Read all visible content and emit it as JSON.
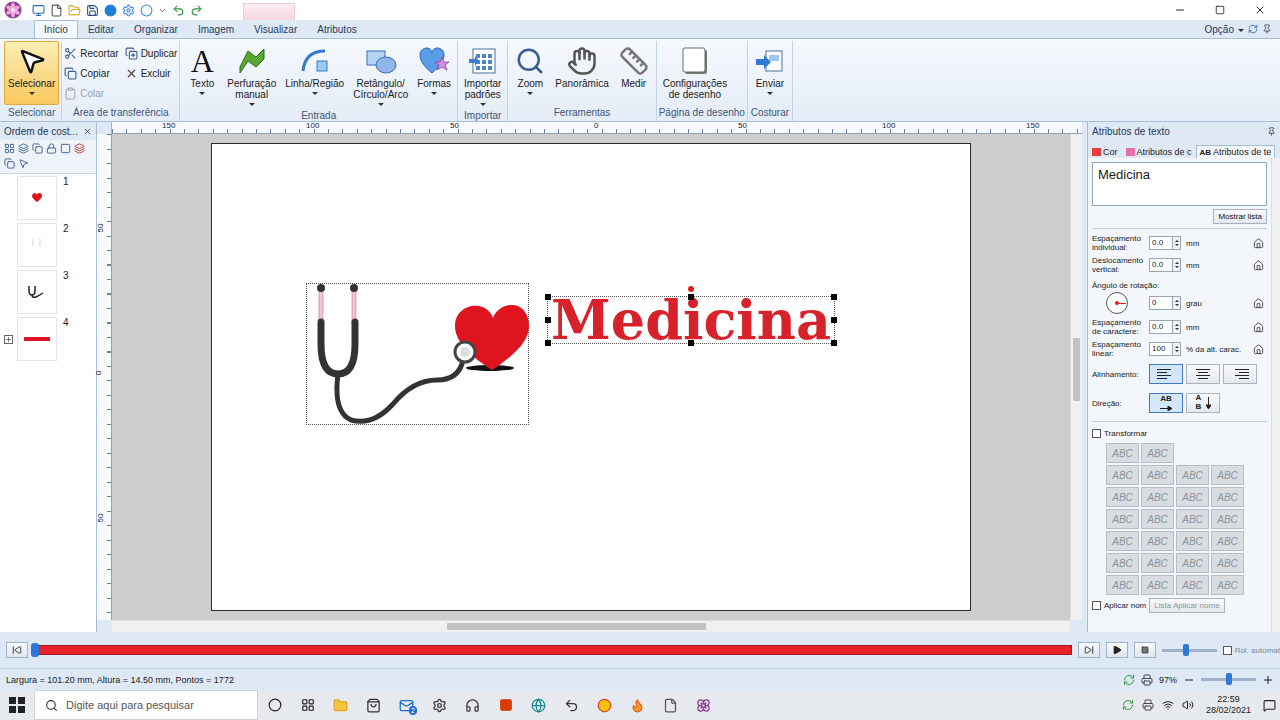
{
  "ribbon": {
    "tabs": [
      {
        "label": "Início",
        "selected": true
      },
      {
        "label": "Editar",
        "selected": false
      },
      {
        "label": "Organizar",
        "selected": false
      },
      {
        "label": "Imagem",
        "selected": false
      },
      {
        "label": "Visualizar",
        "selected": false
      },
      {
        "label": "Atributos",
        "selected": false
      }
    ],
    "option": "Opção",
    "groups": [
      {
        "label": "Selecionar",
        "buttons": [
          {
            "lines": [
              "Selecionar"
            ],
            "size": "large",
            "dropdown": true,
            "selected": true,
            "disabled": false
          }
        ]
      },
      {
        "label": "Área de transferência",
        "buttons": [
          {
            "lines": [
              "Recortar"
            ],
            "size": "small",
            "dropdown": false,
            "selected": false,
            "disabled": false
          },
          {
            "lines": [
              "Copiar"
            ],
            "size": "small",
            "dropdown": false,
            "selected": false,
            "disabled": false
          },
          {
            "lines": [
              "Colar"
            ],
            "size": "small",
            "dropdown": false,
            "selected": false,
            "disabled": true
          },
          {
            "lines": [
              "Duplicar"
            ],
            "size": "small",
            "dropdown": false,
            "selected": false,
            "disabled": false
          },
          {
            "lines": [
              "Excluir"
            ],
            "size": "small",
            "dropdown": false,
            "selected": false,
            "disabled": false
          }
        ]
      },
      {
        "label": "Entrada",
        "buttons": [
          {
            "lines": [
              "Texto"
            ],
            "glyph": "A",
            "size": "large",
            "dropdown": true,
            "selected": false,
            "disabled": false
          },
          {
            "lines": [
              "Perfuração",
              "manual"
            ],
            "size": "large",
            "dropdown": true,
            "selected": false,
            "disabled": false
          },
          {
            "lines": [
              "Linha/Região"
            ],
            "size": "large",
            "dropdown": true,
            "selected": false,
            "disabled": false
          },
          {
            "lines": [
              "Retângulo/",
              "Círculo/Arco"
            ],
            "size": "large",
            "dropdown": true,
            "selected": false,
            "disabled": false
          },
          {
            "lines": [
              "Formas"
            ],
            "size": "large",
            "dropdown": true,
            "selected": false,
            "disabled": false
          }
        ]
      },
      {
        "label": "Importar",
        "buttons": [
          {
            "lines": [
              "Importar",
              "padrões"
            ],
            "size": "large",
            "dropdown": true,
            "selected": false,
            "disabled": false
          }
        ]
      },
      {
        "label": "Ferramentas",
        "buttons": [
          {
            "lines": [
              "Zoom"
            ],
            "size": "large",
            "dropdown": true,
            "selected": false,
            "disabled": false
          },
          {
            "lines": [
              "Panorâmica"
            ],
            "size": "large",
            "dropdown": false,
            "selected": false,
            "disabled": false
          },
          {
            "lines": [
              "Medir"
            ],
            "size": "large",
            "dropdown": false,
            "selected": false,
            "disabled": false
          }
        ]
      },
      {
        "label": "Página de desenho",
        "buttons": [
          {
            "lines": [
              "Configurações",
              "de desenho"
            ],
            "size": "large",
            "dropdown": false,
            "selected": false,
            "disabled": false
          }
        ]
      },
      {
        "label": "Costurar",
        "buttons": [
          {
            "lines": [
              "Enviar"
            ],
            "size": "large",
            "dropdown": true,
            "selected": false,
            "disabled": false
          }
        ]
      }
    ]
  },
  "order_panel": {
    "title": "Ordem de cost...",
    "items": [
      {
        "number": "1",
        "kind": "heart",
        "group": false
      },
      {
        "number": "2",
        "kind": "tube",
        "group": false
      },
      {
        "number": "3",
        "kind": "stethoscope",
        "group": false
      },
      {
        "number": "4",
        "kind": "text",
        "group": true
      }
    ]
  },
  "rulers": {
    "horizontal": [
      "150",
      "100",
      "50",
      "0",
      "50",
      "100",
      "150"
    ],
    "vertical": [
      "50",
      "0",
      "50"
    ]
  },
  "canvas": {
    "elements": [
      {
        "kind": "stethoscope",
        "selected": false
      },
      {
        "kind": "text",
        "text": "Medicina",
        "selected": true
      }
    ]
  },
  "attributes_panel": {
    "title": "Atributos de texto",
    "tabs": [
      {
        "label": "Cor",
        "glyph": "",
        "selected": false
      },
      {
        "label": "Atributos de c",
        "glyph": "",
        "selected": false
      },
      {
        "label": "Atributos de te",
        "glyph": "AB",
        "selected": true
      }
    ],
    "text_value": "Medicina",
    "show_list": "Mostrar lista",
    "fields": [
      {
        "kind": "spin",
        "label": "Espaçamento individual:",
        "value": "0.0",
        "unit": "mm"
      },
      {
        "kind": "spin",
        "label": "Deslocamento vertical:",
        "value": "0.0",
        "unit": "mm"
      },
      {
        "kind": "rotation",
        "label": "Ângulo de rotação:",
        "value": "0",
        "unit": "grau"
      },
      {
        "kind": "spin",
        "label": "Espaçamento de caractere:",
        "value": "0.0",
        "unit": "mm"
      },
      {
        "kind": "spin",
        "label": "Espaçamento linear:",
        "value": "100",
        "unit": "% da alt. carac."
      }
    ],
    "alignment": {
      "label": "Alinhamento:",
      "options": [
        {
          "value": "left",
          "selected": true
        },
        {
          "value": "center",
          "selected": false
        },
        {
          "value": "right",
          "selected": false
        }
      ]
    },
    "direction": {
      "label": "Direção:",
      "options": [
        {
          "kind": "horizontal",
          "glyph": "AB",
          "selected": true
        },
        {
          "kind": "vertical",
          "glyph": "AB",
          "selected": false
        }
      ]
    },
    "transform": {
      "label": "Transformar",
      "checked": false,
      "presets": [
        "ABC",
        "ABC",
        "ABC",
        "ABC",
        "ABC",
        "ABC",
        "ABC",
        "ABC",
        "ABC",
        "ABC",
        "ABC",
        "ABC",
        "ABC",
        "ABC",
        "ABC",
        "ABC",
        "ABC",
        "ABC",
        "ABC",
        "ABC",
        "ABC",
        "ABC",
        "ABC",
        "ABC",
        "ABC",
        "ABC"
      ]
    },
    "apply": {
      "label": "Aplicar nom",
      "checked": false,
      "button": "Lista Aplicar nome"
    }
  },
  "playback": {
    "level": 0,
    "speed_level": 0.45,
    "autoscroll": {
      "label": "Rol. automat",
      "checked": false
    }
  },
  "status_bar": {
    "text": "Largura = 101.20 mm, Altura = 14.50 mm, Pontos = 1772",
    "zoom": "97%",
    "zoom_level": 0.5
  },
  "taskbar": {
    "search_placeholder": "Digite aqui para pesquisar",
    "mail_badge": "2",
    "time": "22:59",
    "date": "28/02/2021"
  }
}
